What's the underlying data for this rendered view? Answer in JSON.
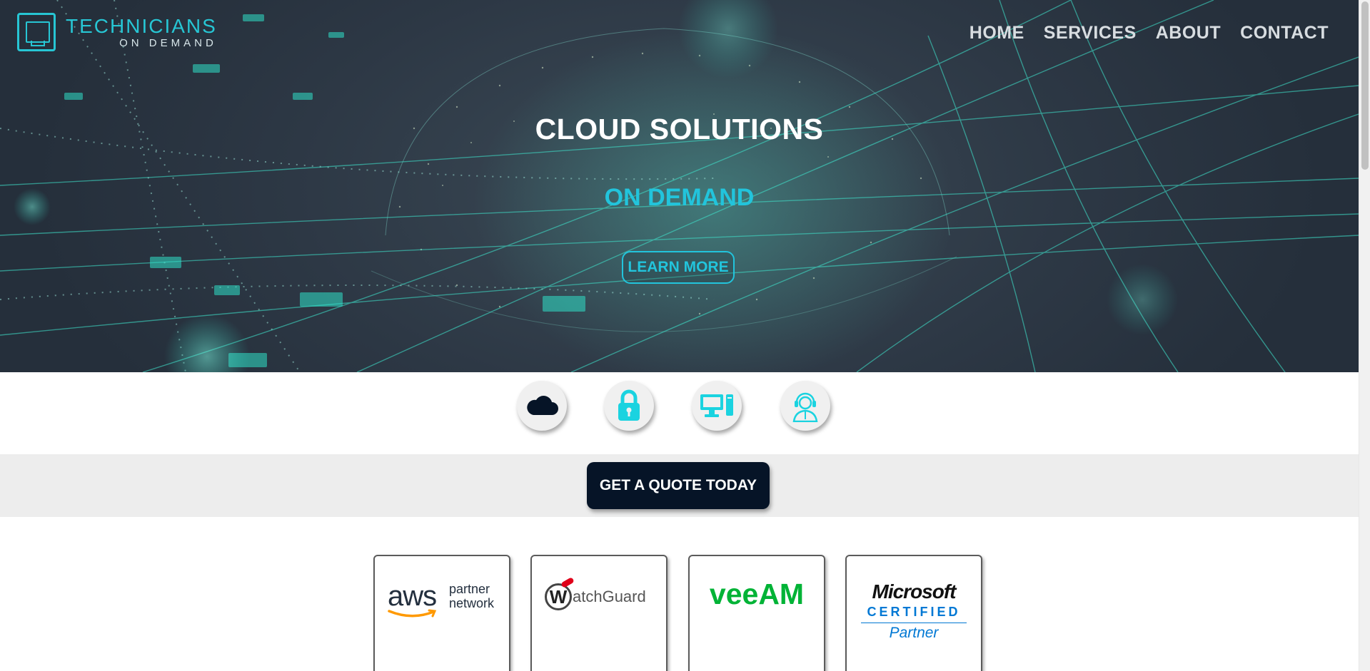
{
  "brand": {
    "name": "TECHNICIANS",
    "tagline": "ON DEMAND",
    "accent": "#27c6d4"
  },
  "nav": {
    "items": [
      {
        "label": "HOME"
      },
      {
        "label": "SERVICES"
      },
      {
        "label": "ABOUT"
      },
      {
        "label": "CONTACT"
      }
    ]
  },
  "hero": {
    "title": "CLOUD SOLUTIONS",
    "subtitle": "ON DEMAND",
    "cta_label": "LEARN MORE"
  },
  "services": {
    "icons": [
      "cloud-icon",
      "lock-icon",
      "desktop-computer-icon",
      "support-agent-icon"
    ],
    "active_color": "#061427",
    "icon_color": "#1ad3e0"
  },
  "quote": {
    "label": "GET A QUOTE TODAY",
    "button_color": "#061427"
  },
  "partners": {
    "aws": {
      "word": "aws",
      "line1": "partner",
      "line2": "network"
    },
    "watchguard": {
      "initial": "W",
      "rest": "atchGuard"
    },
    "veeam": {
      "name": "veeAM"
    },
    "microsoft": {
      "name": "Microsoft",
      "certified": "CERTIFIED",
      "partner": "Partner"
    }
  }
}
